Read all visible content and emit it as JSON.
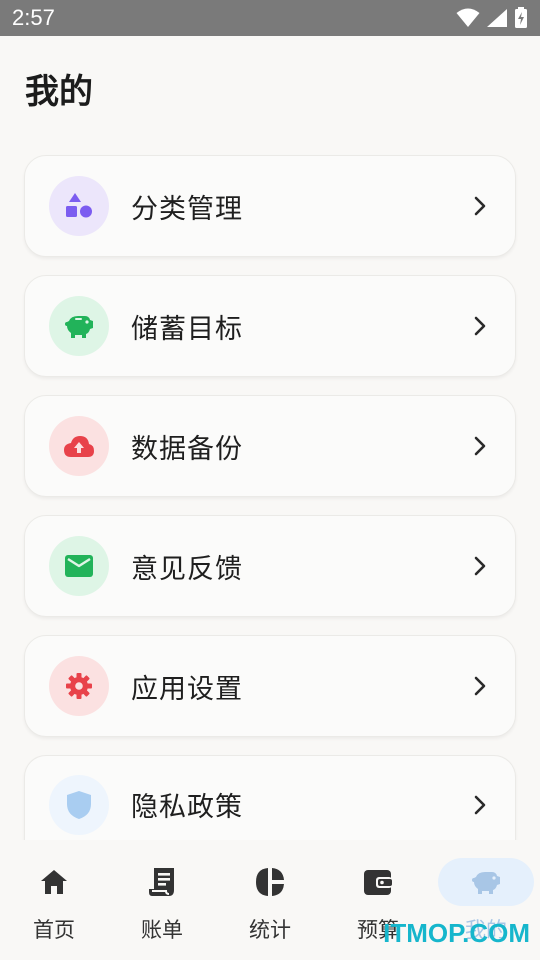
{
  "status_bar": {
    "time": "2:57",
    "icons": [
      "wifi-icon",
      "signal-icon",
      "battery-icon"
    ]
  },
  "page": {
    "title": "我的"
  },
  "menu": [
    {
      "label": "分类管理",
      "icon": "shapes-icon",
      "icon_color": "#7b5cf0",
      "icon_bg": "#ece6fb"
    },
    {
      "label": "储蓄目标",
      "icon": "piggy-bank-icon",
      "icon_color": "#22b35a",
      "icon_bg": "#def5e6"
    },
    {
      "label": "数据备份",
      "icon": "cloud-upload-icon",
      "icon_color": "#e8424a",
      "icon_bg": "#fbe1e1"
    },
    {
      "label": "意见反馈",
      "icon": "mail-icon",
      "icon_color": "#22b35a",
      "icon_bg": "#def5e6"
    },
    {
      "label": "应用设置",
      "icon": "gear-icon",
      "icon_color": "#e8424a",
      "icon_bg": "#fbe1e1"
    },
    {
      "label": "隐私政策",
      "icon": "shield-icon",
      "icon_color": "#a9cdf1",
      "icon_bg": "#eef5fd"
    }
  ],
  "bottom_nav": [
    {
      "label": "首页",
      "icon": "home-icon",
      "active": false
    },
    {
      "label": "账单",
      "icon": "receipt-icon",
      "active": false
    },
    {
      "label": "统计",
      "icon": "pie-chart-icon",
      "active": false
    },
    {
      "label": "预算",
      "icon": "wallet-icon",
      "active": false
    },
    {
      "label": "我的",
      "icon": "piggy-bank-icon",
      "active": true
    }
  ],
  "watermark": "ITMOP.COM"
}
